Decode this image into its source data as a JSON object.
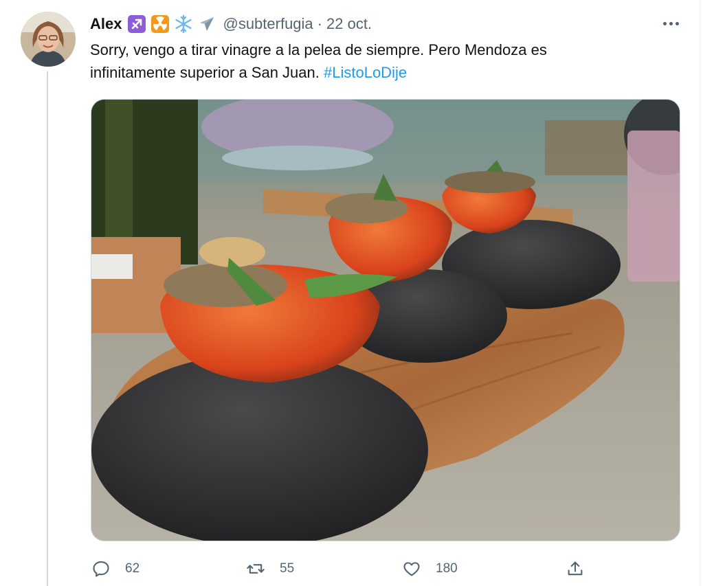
{
  "tweet": {
    "display_name": "Alex",
    "emoji_icons": [
      "sagittarius-icon",
      "radioactive-icon",
      "snowflake-icon",
      "airplane-icon"
    ],
    "handle": "@subterfugia",
    "separator": "·",
    "date": "22 oct.",
    "text_main": "Sorry, vengo a tirar vinagre a la pelea de siempre. Pero Mendoza es infinitamente superior a San Juan.",
    "hashtag": "#ListoLoDije",
    "media_icon": "photo-of-stuffed-tomatoes-on-stones",
    "actions": {
      "reply_count": "62",
      "retweet_count": "55",
      "like_count": "180"
    },
    "colors": {
      "accent": "#1d9bf0",
      "secondary_text": "#536471",
      "primary_text": "#0f1419",
      "thread_line": "#cfd9de"
    }
  }
}
